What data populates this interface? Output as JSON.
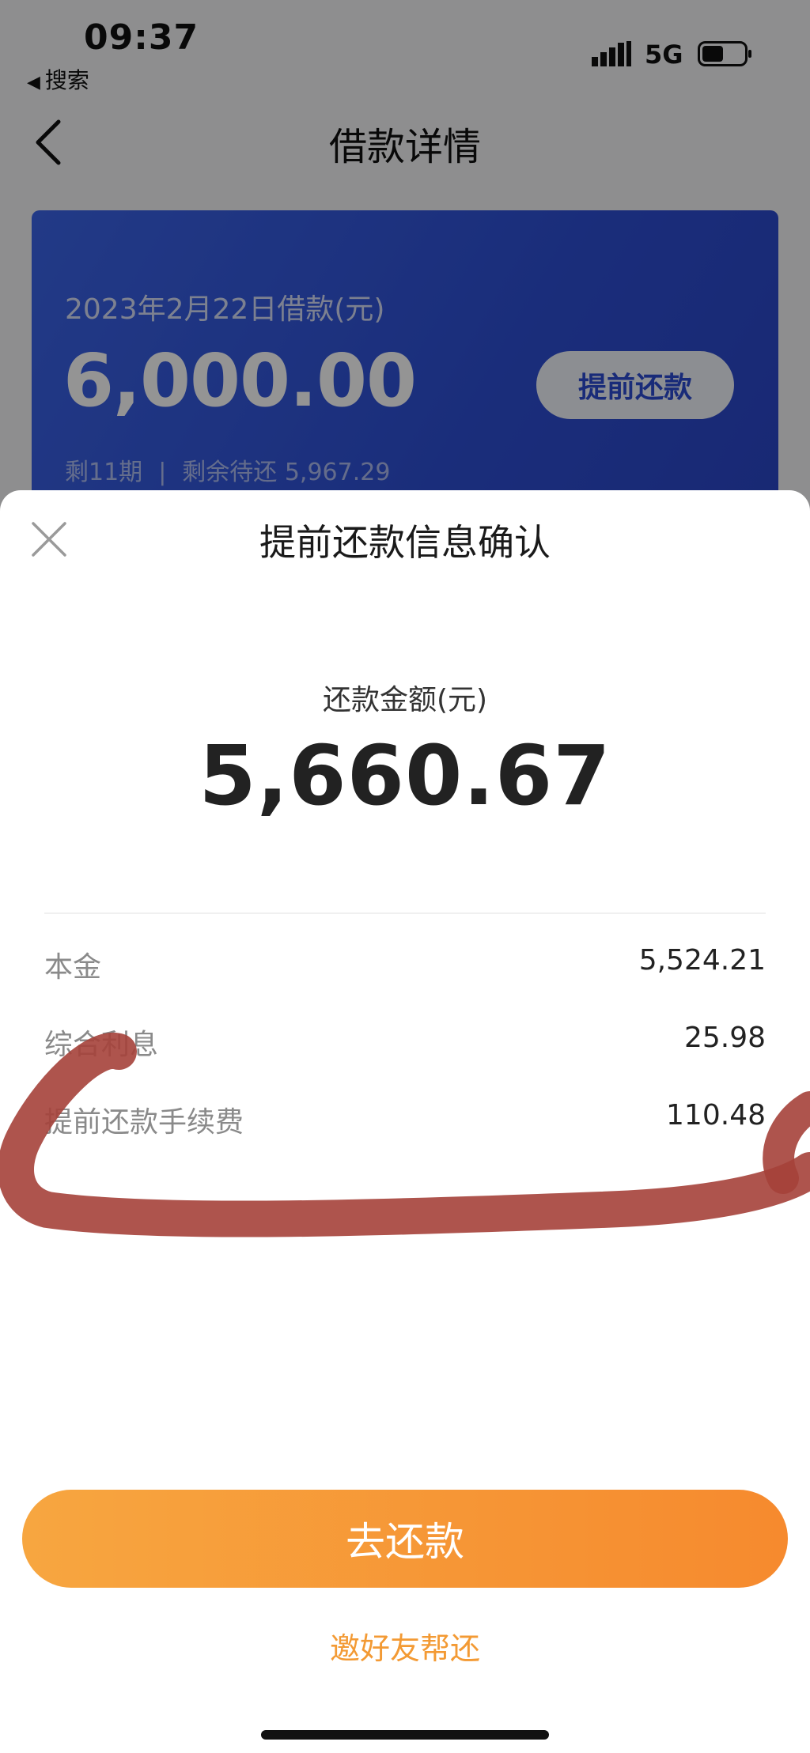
{
  "status_bar": {
    "time": "09:37",
    "back_app_label": "搜索",
    "network": "5G"
  },
  "nav": {
    "title": "借款详情"
  },
  "loan_card": {
    "date_label": "2023年2月22日借款(元)",
    "amount": "6,000.00",
    "prepay_button": "提前还款",
    "remaining_periods": "剩11期",
    "remaining_due_label": "剩余待还",
    "remaining_due_value": "5,967.29"
  },
  "sheet": {
    "title": "提前还款信息确认",
    "amount_label": "还款金额(元)",
    "amount_value": "5,660.67",
    "details": [
      {
        "label": "本金",
        "value": "5,524.21"
      },
      {
        "label": "综合利息",
        "value": "25.98"
      },
      {
        "label": "提前还款手续费",
        "value": "110.48"
      }
    ],
    "pay_button": "去还款",
    "invite_link": "邀好友帮还"
  },
  "colors": {
    "card_blue": "#2e4fd4",
    "button_orange": "#f68a2e",
    "link_orange": "#f39a34",
    "scribble_red": "#a5413a"
  },
  "icons": [
    "back-chevron-icon",
    "signal-icon",
    "battery-icon",
    "close-icon",
    "chevron-right-icon"
  ]
}
